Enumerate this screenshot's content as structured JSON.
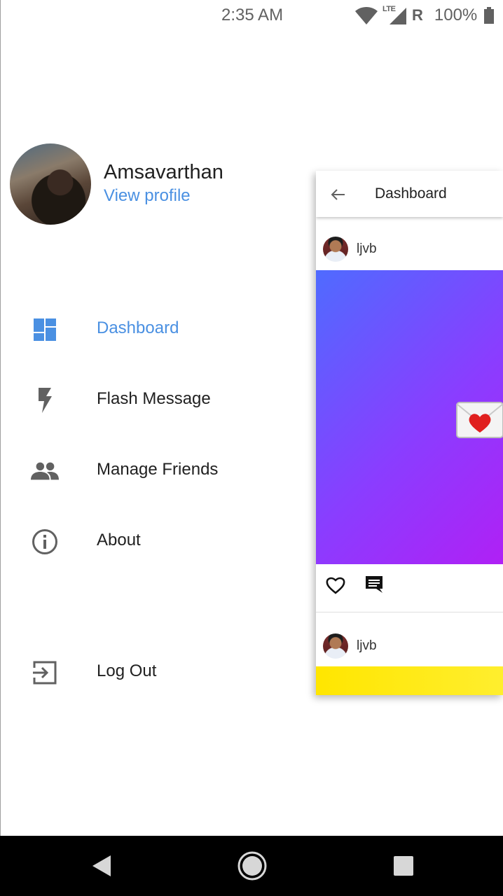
{
  "status_bar": {
    "time": "2:35 AM",
    "network": "LTE",
    "roaming": "R",
    "battery": "100%"
  },
  "profile": {
    "name": "Amsavarthan",
    "view_profile_label": "View profile"
  },
  "menu": {
    "items": [
      {
        "label": "Dashboard",
        "icon": "dashboard-icon",
        "active": true
      },
      {
        "label": "Flash Message",
        "icon": "flash-icon",
        "active": false
      },
      {
        "label": "Manage Friends",
        "icon": "people-icon",
        "active": false
      },
      {
        "label": "About",
        "icon": "info-icon",
        "active": false
      }
    ],
    "logout": {
      "label": "Log Out",
      "icon": "logout-icon"
    }
  },
  "preview": {
    "title": "Dashboard",
    "posts": [
      {
        "username": "ljvb"
      },
      {
        "username": "ljvb"
      }
    ]
  },
  "colors": {
    "accent": "#4a90e2",
    "icon_gray": "#616161",
    "post_gradient_start": "#4f6bff",
    "post_gradient_end": "#b020f5",
    "second_post_color": "#ffe600"
  },
  "nav_bar": [
    "back-icon",
    "home-icon",
    "recents-icon"
  ]
}
